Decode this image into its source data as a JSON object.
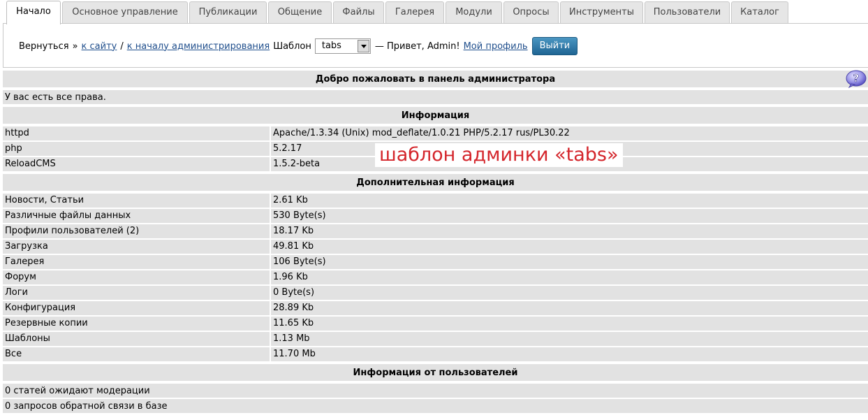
{
  "tabs": [
    {
      "label": "Начало",
      "active": true
    },
    {
      "label": "Основное управление"
    },
    {
      "label": "Публикации"
    },
    {
      "label": "Общение"
    },
    {
      "label": "Файлы"
    },
    {
      "label": "Галерея"
    },
    {
      "label": "Модули"
    },
    {
      "label": "Опросы"
    },
    {
      "label": "Инструменты"
    },
    {
      "label": "Пользователи"
    },
    {
      "label": "Каталог"
    }
  ],
  "toolbar": {
    "back_text": "Вернуться",
    "arrow": "»",
    "site_link": "к сайту",
    "slash": "/",
    "admin_link": "к началу администрирования",
    "template_label": "Шаблон",
    "template_value": "tabs",
    "greeting": "— Привет, Admin!",
    "profile_link": "Мой профиль",
    "logout_label": "Выйти"
  },
  "welcome": {
    "title": "Добро пожаловать в панель администратора",
    "rights": "У вас есть все права."
  },
  "info": {
    "title": "Информация",
    "rows": [
      {
        "key": "httpd",
        "value": "Apache/1.3.34 (Unix) mod_deflate/1.0.21 PHP/5.2.17 rus/PL30.22"
      },
      {
        "key": "php",
        "value": "5.2.17"
      },
      {
        "key": "ReloadCMS",
        "value": "1.5.2-beta"
      }
    ]
  },
  "extra": {
    "title": "Дополнительная информация",
    "rows": [
      {
        "key": "Новости, Статьи",
        "value": "2.61 Kb"
      },
      {
        "key": "Различные файлы данных",
        "value": "530 Byte(s)"
      },
      {
        "key": "Профили пользователей (2)",
        "value": "18.17 Kb"
      },
      {
        "key": "Загрузка",
        "value": "49.81 Kb"
      },
      {
        "key": "Галерея",
        "value": "106 Byte(s)"
      },
      {
        "key": "Форум",
        "value": "1.96 Kb"
      },
      {
        "key": "Логи",
        "value": "0 Byte(s)"
      },
      {
        "key": "Конфигурация",
        "value": "28.89 Kb"
      },
      {
        "key": "Резервные копии",
        "value": "11.65 Kb"
      },
      {
        "key": "Шаблоны",
        "value": "1.13 Mb"
      },
      {
        "key": "Все",
        "value": "11.70 Mb"
      }
    ]
  },
  "users": {
    "title": "Информация от пользователей",
    "rows": [
      "0 статей ожидают модерации",
      "0 запросов обратной связи в базе"
    ]
  },
  "annotation": "шаблон админки «tabs»",
  "colors": {
    "annotation_text": "#d4252b",
    "link": "#1f4e8c",
    "logout_button": "#2f7aa7",
    "row_background": "#e2e2e2"
  },
  "icons": {
    "help": "help-icon"
  }
}
